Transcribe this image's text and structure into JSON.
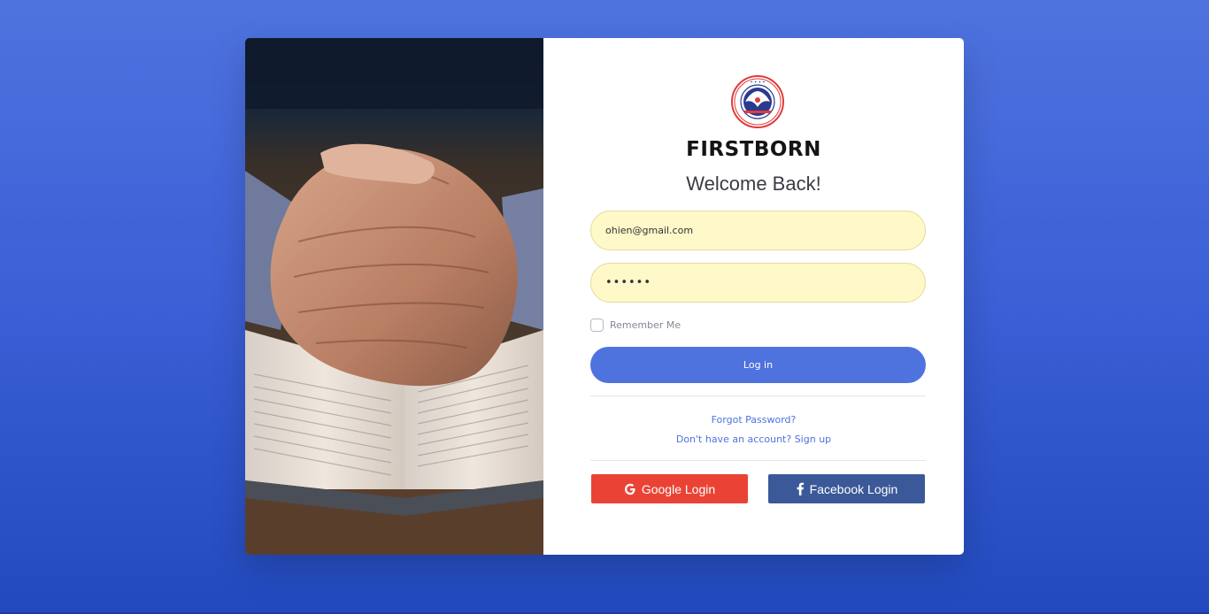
{
  "brand": {
    "name": "FIRSTBORN",
    "logo_icon": "church-seal-logo",
    "logo_ring_text": "THE REDEEMED CHRISTIAN CHURCH OF GOD"
  },
  "welcome": "Welcome Back!",
  "form": {
    "email_value": "ohien@gmail.com",
    "password_value": "••••••",
    "remember_label": "Remember Me",
    "login_label": "Log in",
    "forgot_label": "Forgot Password?",
    "signup_label": "Don't have an account? Sign up"
  },
  "social": {
    "google_label": "Google Login",
    "google_icon": "google-icon",
    "facebook_label": "Facebook Login",
    "facebook_icon": "facebook-icon"
  },
  "colors": {
    "accent": "#4e73df",
    "google": "#ea4335",
    "facebook": "#3b5998",
    "input_bg": "#fff8c8"
  }
}
